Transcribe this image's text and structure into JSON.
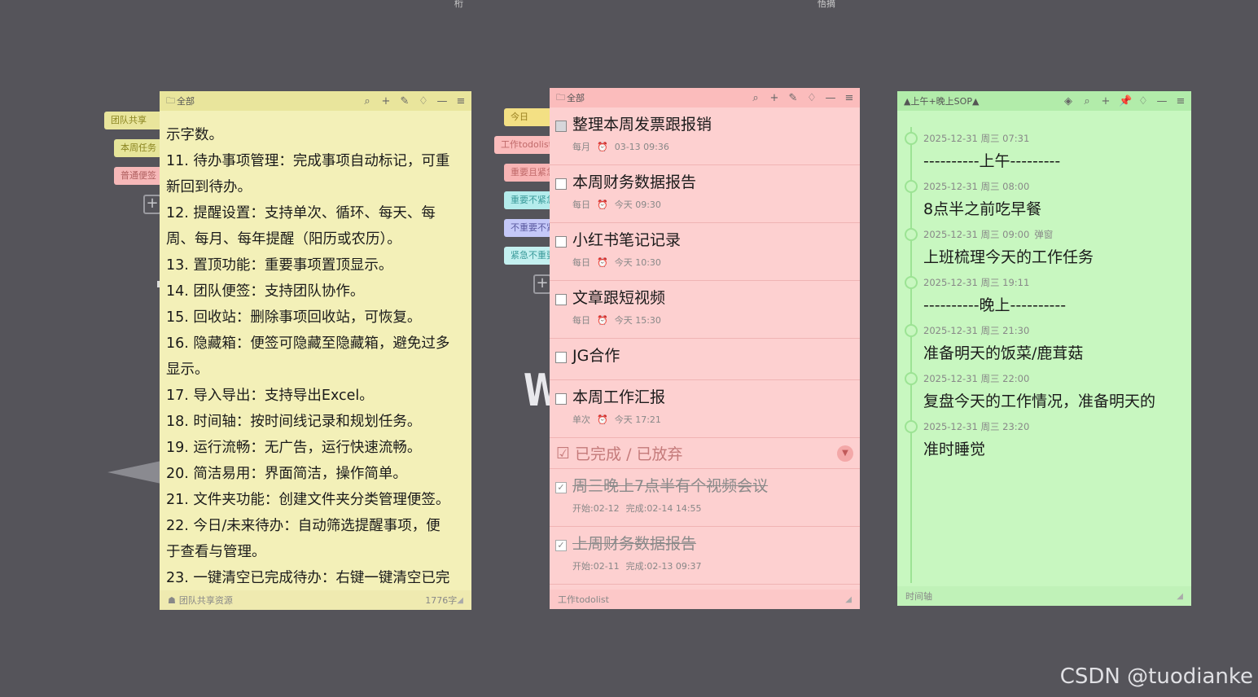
{
  "stray_marks": [
    "桁",
    "悟摘"
  ],
  "deco": {
    "w_letter": "W"
  },
  "yellow_tabs": [
    {
      "label": "团队共享",
      "bg": "#e9e59c",
      "color": "#8a8420"
    },
    {
      "label": "本周任务",
      "bg": "#e6e59a",
      "color": "#8a8420"
    },
    {
      "label": "普通便签",
      "bg": "#f6b8b8",
      "color": "#b06060"
    }
  ],
  "red_tabs": [
    {
      "label": "今日",
      "bg": "#f3e084",
      "color": "#9a8020"
    },
    {
      "label": "工作todolist",
      "bg": "#fbbcbc",
      "color": "#c06a6a"
    },
    {
      "label": "重要且紧急",
      "bg": "#f8b4b4",
      "color": "#c06a6a"
    },
    {
      "label": "重要不紧急",
      "bg": "#b4ecec",
      "color": "#3a9a9a"
    },
    {
      "label": "不重要不紧急",
      "bg": "#c4c8f8",
      "color": "#5a5aa0"
    },
    {
      "label": "紧急不重要",
      "bg": "#c4f0f0",
      "color": "#3a9a9a"
    }
  ],
  "yellow": {
    "folder": "全部",
    "lines": [
      "示字数。",
      "11. 待办事项管理：完成事项自动标记，可重",
      "新回到待办。",
      "12. 提醒设置：支持单次、循环、每天、每",
      "周、每月、每年提醒（阳历或农历）。",
      "13. 置顶功能：重要事项置顶显示。",
      "14. 团队便签：支持团队协作。",
      "15. 回收站：删除事项回收站，可恢复。",
      "16. 隐藏箱：便签可隐藏至隐藏箱，避免过多",
      "显示。",
      "17. 导入导出：支持导出Excel。",
      "18. 时间轴：按时间线记录和规划任务。",
      "19. 运行流畅：无广告，运行快速流畅。",
      "20. 简洁易用：界面简洁，操作简单。",
      "21. 文件夹功能：创建文件夹分类管理便签。",
      "22. 今日/未来待办：自动筛选提醒事项，便",
      "于查看与管理。",
      "23. 一键清空已完成待办：右键一键清空已完"
    ],
    "footer_label": "团队共享资源",
    "word_count": "1776字"
  },
  "red": {
    "folder": "全部",
    "todos": [
      {
        "text": "整理本周发票跟报销",
        "repeat": "每月",
        "time": "03-13 09:36"
      },
      {
        "text": "本周财务数据报告",
        "repeat": "每日",
        "time": "今天 09:30"
      },
      {
        "text": "小红书笔记记录",
        "repeat": "每日",
        "time": "今天 10:30"
      },
      {
        "text": "文章跟短视频",
        "repeat": "每日",
        "time": "今天 15:30"
      },
      {
        "text": "JG合作"
      },
      {
        "text": "本周工作汇报",
        "repeat": "单次",
        "time": "今天 17:21"
      }
    ],
    "done_header": "已完成 / 已放弃",
    "done": [
      {
        "text": "周三晚上7点半有个视频会议",
        "start": "开始:02-12",
        "finish": "完成:02-14 14:55"
      },
      {
        "text": "上周财务数据报告",
        "start": "开始:02-11",
        "finish": "完成:02-13 09:37"
      }
    ],
    "footer_label": "工作todolist"
  },
  "green": {
    "title": "▲上午+晚上SOP▲",
    "items": [
      {
        "date": "2025-12-31 周三 07:31",
        "text": "----------上午---------"
      },
      {
        "date": "2025-12-31 周三 08:00",
        "text": "8点半之前吃早餐"
      },
      {
        "date": "2025-12-31 周三 09:00",
        "tag": "弹窗",
        "text": "上班梳理今天的工作任务"
      },
      {
        "date": "2025-12-31 周三 19:11",
        "text": "----------晚上----------"
      },
      {
        "date": "2025-12-31 周三 21:30",
        "text": "准备明天的饭菜/鹿茸菇"
      },
      {
        "date": "2025-12-31 周三 22:00",
        "text": "复盘今天的工作情况，准备明天的"
      },
      {
        "date": "2025-12-31 周三 23:20",
        "text": "准时睡觉"
      }
    ],
    "footer_label": "时间轴"
  },
  "watermark": "CSDN @tuodianke"
}
